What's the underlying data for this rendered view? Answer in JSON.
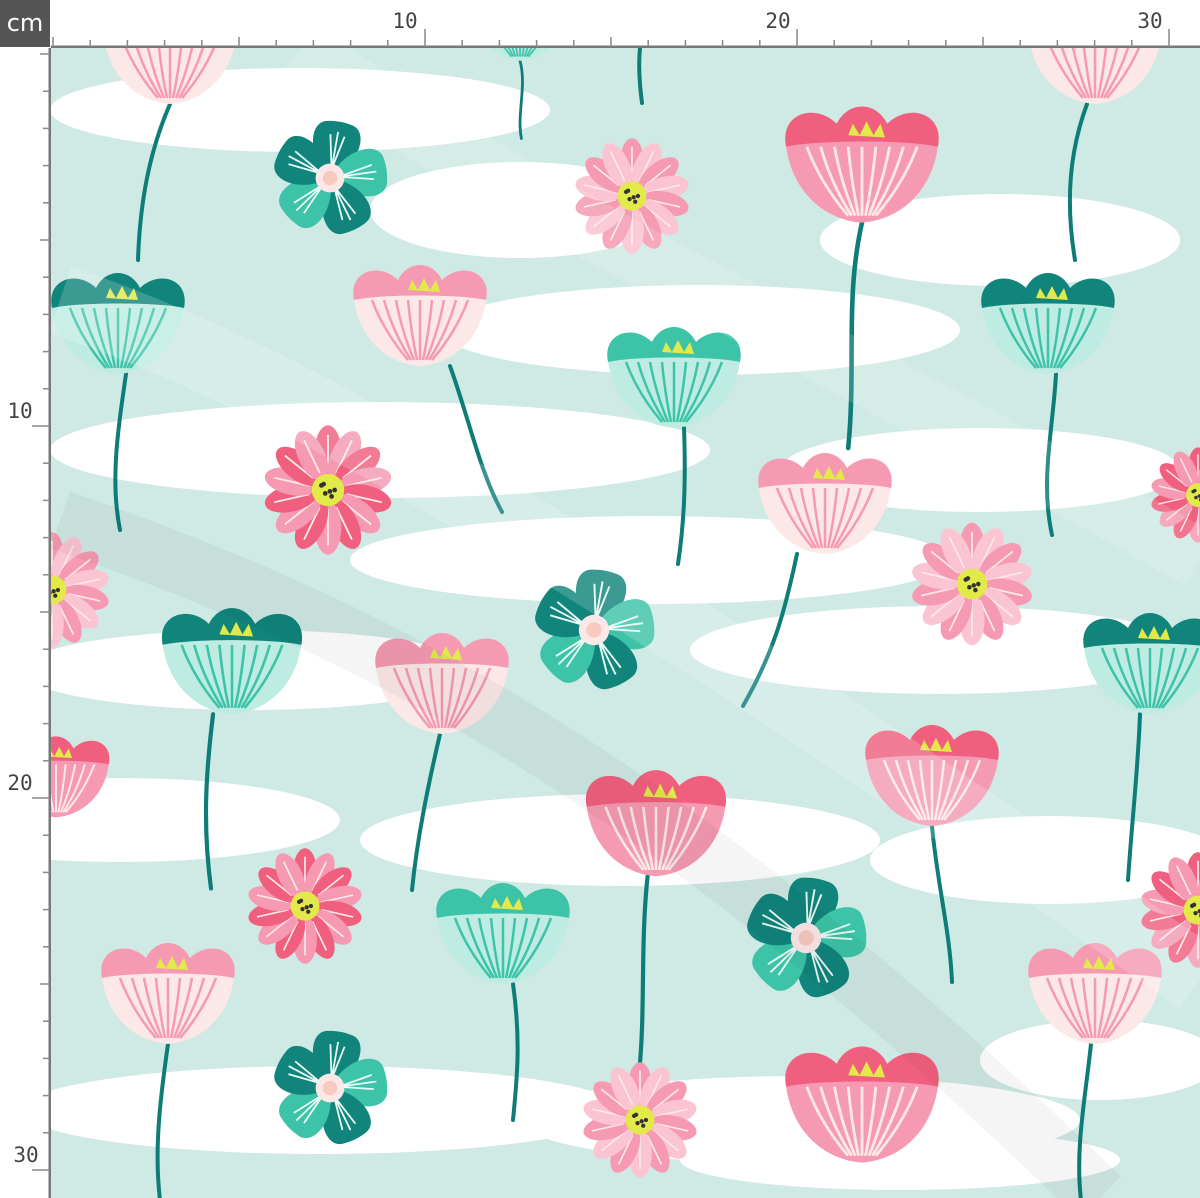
{
  "ruler": {
    "unit": "cm",
    "top_labels": [
      "10",
      "20",
      "30"
    ],
    "left_labels": [
      "10",
      "20",
      "30"
    ]
  },
  "fabric": {
    "pattern": "floral",
    "background_color": "#cfe9e4",
    "cloud_color": "#ffffff",
    "stem_color": "#0e7c78",
    "accent_colors": [
      "#f0607e",
      "#f59ab2",
      "#fde8e8",
      "#11857c",
      "#3dc4a8",
      "#e2ea4a"
    ]
  }
}
